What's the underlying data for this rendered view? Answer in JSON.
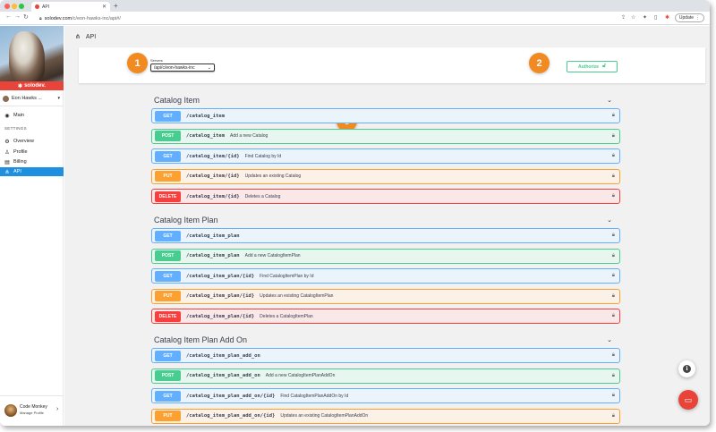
{
  "browser": {
    "tab_title": "API",
    "url_host": "solodev.com",
    "url_path": "/c/eon-hawks-inc/api#/",
    "update_label": "Update"
  },
  "sidebar": {
    "logo_text": "solodev.",
    "org_name": "Eon Hawks ...",
    "main_label": "Main",
    "settings_label": "SETTINGS",
    "items": [
      {
        "label": "Overview",
        "icon": "gear-icon"
      },
      {
        "label": "Profile",
        "icon": "user-icon"
      },
      {
        "label": "Billing",
        "icon": "billing-icon"
      },
      {
        "label": "API",
        "icon": "api-icon",
        "active": true
      }
    ],
    "user": {
      "name": "Code Monkey",
      "sub": "Manage Profile"
    }
  },
  "page": {
    "title": "API"
  },
  "servers": {
    "label": "Servers",
    "selected": "/api/c/eon-hawks-inc"
  },
  "authorize_label": "Authorize",
  "callouts": [
    "1",
    "2",
    "3"
  ],
  "groups": [
    {
      "title": "Catalog Item",
      "ops": [
        {
          "method": "GET",
          "path": "/catalog_item",
          "desc": ""
        },
        {
          "method": "POST",
          "path": "/catalog_item",
          "desc": "Add a new Catalog"
        },
        {
          "method": "GET",
          "path": "/catalog_item/{id}",
          "desc": "Find Catalog by Id"
        },
        {
          "method": "PUT",
          "path": "/catalog_item/{id}",
          "desc": "Updates an existing Catalog"
        },
        {
          "method": "DELETE",
          "path": "/catalog_item/{id}",
          "desc": "Deletes a Catalog"
        }
      ]
    },
    {
      "title": "Catalog Item Plan",
      "ops": [
        {
          "method": "GET",
          "path": "/catalog_item_plan",
          "desc": ""
        },
        {
          "method": "POST",
          "path": "/catalog_item_plan",
          "desc": "Add a new CatalogItemPlan"
        },
        {
          "method": "GET",
          "path": "/catalog_item_plan/{id}",
          "desc": "Find CatalogItemPlan by Id"
        },
        {
          "method": "PUT",
          "path": "/catalog_item_plan/{id}",
          "desc": "Updates an existing CatalogItemPlan"
        },
        {
          "method": "DELETE",
          "path": "/catalog_item_plan/{id}",
          "desc": "Deletes a CatalogItemPlan"
        }
      ]
    },
    {
      "title": "Catalog Item Plan Add On",
      "ops": [
        {
          "method": "GET",
          "path": "/catalog_item_plan_add_on",
          "desc": ""
        },
        {
          "method": "POST",
          "path": "/catalog_item_plan_add_on",
          "desc": "Add a new CatalogItemPlanAddOn"
        },
        {
          "method": "GET",
          "path": "/catalog_item_plan_add_on/{id}",
          "desc": "Find CatalogItemPlanAddOn by Id"
        },
        {
          "method": "PUT",
          "path": "/catalog_item_plan_add_on/{id}",
          "desc": "Updates an existing CatalogItemPlanAddOn"
        }
      ]
    }
  ],
  "colors": {
    "get": "#61affe",
    "post": "#49cc90",
    "put": "#fca130",
    "delete": "#f93e3e",
    "brand": "#e8443a",
    "active_nav": "#1f8fe0",
    "callout": "#f28a22"
  }
}
